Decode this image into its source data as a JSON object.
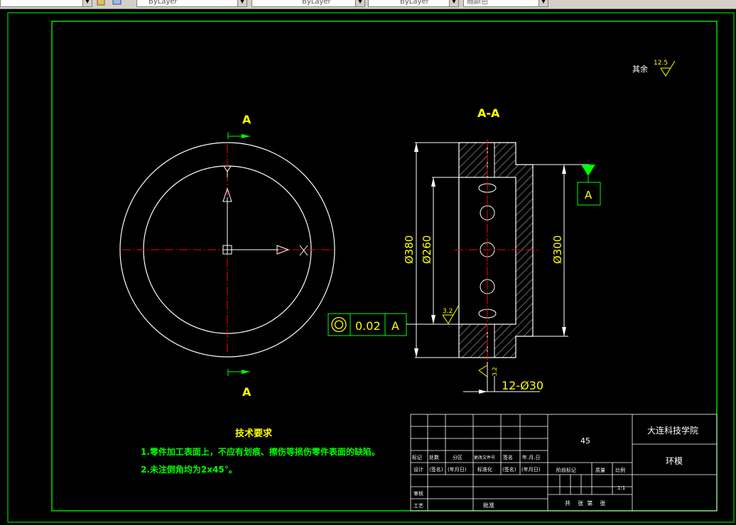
{
  "toolbar": {
    "layer_combo_1": "ByLayer",
    "layer_combo_2": "ByLayer",
    "lineweight_combo": "ByLayer",
    "color_combo": "随颜色"
  },
  "drawing": {
    "roughness_label": "其余",
    "roughness_value": "12.5",
    "section_mark_top": "A",
    "section_mark_bottom": "A",
    "section_view_label": "A-A",
    "dim_outer_diameter": "Ø380",
    "dim_inner_diameter": "Ø260",
    "dim_right_diameter": "Ø300",
    "datum_label": "A",
    "tolerance_value": "0.02",
    "tolerance_datum": "A",
    "inner_roughness": "3.2",
    "hole_roughness": "3.2",
    "hole_callout": "12-Ø30",
    "tech_title": "技术要求",
    "tech_req_1": "1.零件加工表面上，不应有划痕、擦伤等损伤零件表面的缺陷。",
    "tech_req_2": "2.未注倒角均为2x45°。"
  },
  "title_block": {
    "material": "45",
    "school": "大连科技学院",
    "part_name": "环模",
    "row_labels_1": [
      "标记",
      "处数",
      "分区",
      "更改文件号",
      "签名",
      "年.月.日"
    ],
    "row_labels_2": [
      "设计",
      "(签名)",
      "(年月日)",
      "标准化",
      "(签名)",
      "(年月日)"
    ],
    "stage_label": "阶段标记",
    "weight_label": "质量",
    "scale_label": "比例",
    "scale_value": "1:1",
    "review_label": "审核",
    "process_label": "工艺",
    "approve_label": "批准",
    "sheet_info": "共    张  第    张"
  },
  "colors": {
    "frame": "#00ff00",
    "geometry": "#ffffff",
    "centerline": "#ff0000",
    "text_yellow": "#ffff00",
    "text_green": "#00ff00"
  }
}
